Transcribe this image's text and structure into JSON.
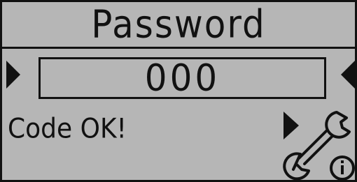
{
  "header": {
    "title": "Password"
  },
  "code_field": {
    "value": "000"
  },
  "status": {
    "message": "Code OK!"
  },
  "icons": {
    "left_arrow": "triangle-right-icon",
    "right_arrow": "triangle-left-icon",
    "tools": "wrench-info-icon"
  },
  "colors": {
    "background": "#b6b6b6",
    "foreground": "#111111"
  }
}
